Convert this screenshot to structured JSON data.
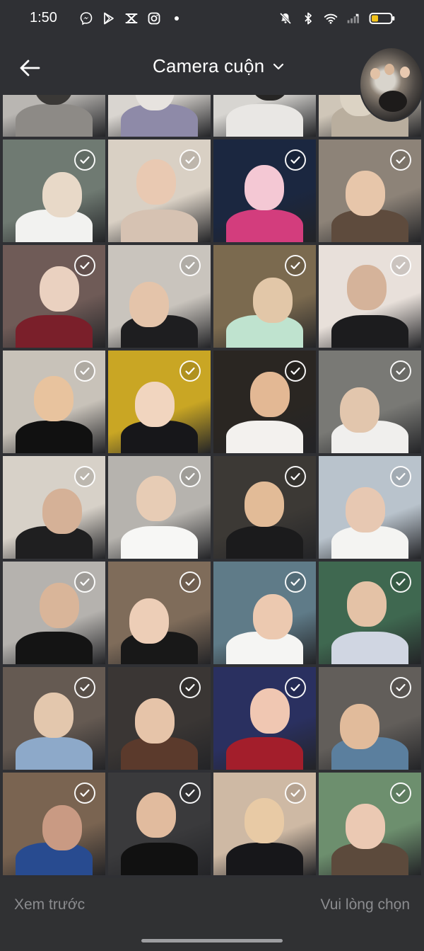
{
  "status_bar": {
    "time": "1:50",
    "left_icons": [
      "messenger-icon",
      "play-store-icon",
      "capcut-icon",
      "instagram-icon",
      "dot-icon"
    ],
    "right_icons": [
      "mute-icon",
      "bluetooth-icon",
      "wifi-icon",
      "signal-icon",
      "battery-icon"
    ],
    "battery_color": "#f2c21a"
  },
  "header": {
    "title": "Camera cuộn",
    "back_icon": "arrow-left-icon",
    "dropdown_icon": "chevron-down-icon"
  },
  "grid": {
    "check_icon": "check-circle-icon",
    "photos": [
      {
        "colors": [
          "#b9b6b2",
          "#3a3836",
          "#8d8a86"
        ],
        "checked": false
      },
      {
        "colors": [
          "#d9d5d0",
          "#e7e3df",
          "#8e8aa8"
        ],
        "checked": false
      },
      {
        "colors": [
          "#d7d5d1",
          "#262524",
          "#e9e7e4"
        ],
        "checked": false
      },
      {
        "colors": [
          "#cfc6b8",
          "#dcd3c4",
          "#b9ae9e"
        ],
        "checked": false
      },
      {
        "colors": [
          "#6f7a72",
          "#e8d9c8",
          "#f2f2f0"
        ],
        "checked": true
      },
      {
        "colors": [
          "#d9d0c4",
          "#e9c9b2",
          "#d6c2b2"
        ],
        "checked": true
      },
      {
        "colors": [
          "#1b2740",
          "#f4c8d4",
          "#d33d7d"
        ],
        "checked": true
      },
      {
        "colors": [
          "#8d8378",
          "#e7c6aa",
          "#5e4b3d"
        ],
        "checked": true
      },
      {
        "colors": [
          "#6f5b57",
          "#ead1c0",
          "#7a1f2a"
        ],
        "checked": true
      },
      {
        "colors": [
          "#c9c4bd",
          "#e4c4aa",
          "#1e1e20"
        ],
        "checked": true
      },
      {
        "colors": [
          "#7b6a4f",
          "#e2c7a8",
          "#bfe3cf"
        ],
        "checked": true
      },
      {
        "colors": [
          "#e8e0da",
          "#d5b39a",
          "#1c1c1e"
        ],
        "checked": true
      },
      {
        "colors": [
          "#c8c2b9",
          "#e8c39e",
          "#111111"
        ],
        "checked": true
      },
      {
        "colors": [
          "#c9a624",
          "#f1d5bf",
          "#17171a"
        ],
        "checked": true
      },
      {
        "colors": [
          "#2a2622",
          "#e3b894",
          "#f3f1ee"
        ],
        "checked": true
      },
      {
        "colors": [
          "#797975",
          "#e2c6ad",
          "#f0efed"
        ],
        "checked": true
      },
      {
        "colors": [
          "#d7d1c8",
          "#d5b197",
          "#1f1f20"
        ],
        "checked": true
      },
      {
        "colors": [
          "#b6b3ae",
          "#e7ccb5",
          "#f7f7f5"
        ],
        "checked": true
      },
      {
        "colors": [
          "#3c3935",
          "#e2bb97",
          "#1b1b1c"
        ],
        "checked": true
      },
      {
        "colors": [
          "#b9c3cc",
          "#e7c8b2",
          "#f4f4f2"
        ],
        "checked": true
      },
      {
        "colors": [
          "#b5b2ae",
          "#d9b599",
          "#141414"
        ],
        "checked": true
      },
      {
        "colors": [
          "#7f6c5a",
          "#edceb7",
          "#181818"
        ],
        "checked": true
      },
      {
        "colors": [
          "#5f7b88",
          "#ecc9b0",
          "#f5f5f3"
        ],
        "checked": true
      },
      {
        "colors": [
          "#3f6850",
          "#e4c2a6",
          "#d0d6e2"
        ],
        "checked": true
      },
      {
        "colors": [
          "#655a52",
          "#e3c7ad",
          "#8da9c9"
        ],
        "checked": true
      },
      {
        "colors": [
          "#3a3634",
          "#e6c4a9",
          "#5b3a2c"
        ],
        "checked": true
      },
      {
        "colors": [
          "#2a3060",
          "#f0c7b2",
          "#a31e2b"
        ],
        "checked": true
      },
      {
        "colors": [
          "#625e5a",
          "#e1bb9b",
          "#5b7f9e"
        ],
        "checked": true
      },
      {
        "colors": [
          "#7a6451",
          "#c99a83",
          "#284b90"
        ],
        "checked": true
      },
      {
        "colors": [
          "#3a3a3c",
          "#e1bb9e",
          "#111111"
        ],
        "checked": true
      },
      {
        "colors": [
          "#ceb9a4",
          "#e8caa5",
          "#17171a"
        ],
        "checked": true
      },
      {
        "colors": [
          "#6d8f6e",
          "#ebc9b3",
          "#5c4a3c"
        ],
        "checked": true
      }
    ]
  },
  "bottom_bar": {
    "preview_label": "Xem trước",
    "select_label": "Vui lòng chọn"
  }
}
